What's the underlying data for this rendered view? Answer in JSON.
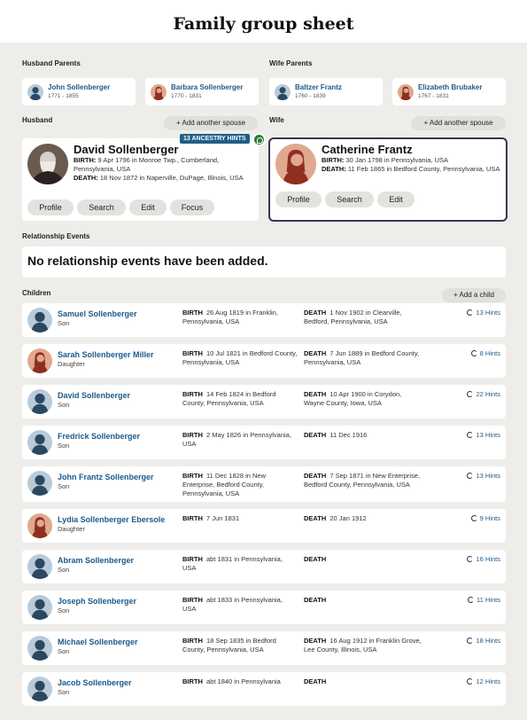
{
  "page": {
    "title": "Family group sheet"
  },
  "labels": {
    "husband_parents": "Husband Parents",
    "wife_parents": "Wife Parents",
    "husband": "Husband",
    "wife": "Wife",
    "relationship_events": "Relationship Events",
    "children": "Children",
    "add_spouse": "+ Add another spouse",
    "add_child": "+ Add a child",
    "birth": "BIRTH",
    "death": "DEATH"
  },
  "husband_parents": [
    {
      "name": "John Sollenberger",
      "dates": "1771 - 1855",
      "gender": "male"
    },
    {
      "name": "Barbara Sollenberger",
      "dates": "1770 - 1831",
      "gender": "female"
    }
  ],
  "wife_parents": [
    {
      "name": "Baltzer Frantz",
      "dates": "1760 - 1839",
      "gender": "male"
    },
    {
      "name": "Elizabeth Brubaker",
      "dates": "1767 - 1831",
      "gender": "female"
    }
  ],
  "husband": {
    "name": "David Sollenberger",
    "birth_label": "BIRTH:",
    "birth": "9 Apr 1796 in Monroe Twp., Cumberland, Pennsylvania, USA",
    "death_label": "DEATH:",
    "death": "18 Nov 1872 in Naperville, DuPage, Illinois, USA",
    "hints_badge": "13 ANCESTRY HINTS",
    "buttons": [
      "Profile",
      "Search",
      "Edit",
      "Focus"
    ]
  },
  "wife": {
    "name": "Catherine Frantz",
    "birth_label": "BIRTH:",
    "birth": "30 Jan 1798 in Pennsylvania, USA",
    "death_label": "DEATH:",
    "death": "11 Feb 1865 in Bedford County, Pennsylvania, USA",
    "buttons": [
      "Profile",
      "Search",
      "Edit"
    ]
  },
  "relationship_events": {
    "empty_text": "No relationship events have been added."
  },
  "children": [
    {
      "name": "Samuel Sollenberger",
      "relation": "Son",
      "gender": "male",
      "birth": "26 Aug 1819  in Franklin, Pennsylvania, USA",
      "death": "1 Nov 1902  in Clearville, Bedford, Pennsylvania, USA",
      "hints": "13 Hints"
    },
    {
      "name": "Sarah Sollenberger Miller",
      "relation": "Daughter",
      "gender": "female",
      "birth": "10 Jul 1821  in Bedford County, Pennsylvania, USA",
      "death": "7 Jun 1889  in Bedford County, Pennsylvania, USA",
      "hints": "8 Hints"
    },
    {
      "name": "David Sollenberger",
      "relation": "Son",
      "gender": "male",
      "birth": "14 Feb 1824  in Bedford County, Pennsylvania, USA",
      "death": "10 Apr 1900  in Corydon, Wayne County, Iowa, USA",
      "hints": "22 Hints"
    },
    {
      "name": "Fredrick Sollenberger",
      "relation": "Son",
      "gender": "male",
      "birth": "2 May 1826  in Pennsylvania, USA",
      "death": "11 Dec 1916",
      "hints": "13 Hints"
    },
    {
      "name": "John Frantz Sollenberger",
      "relation": "Son",
      "gender": "male",
      "birth": "11 Dec 1828  in New Enterprise, Bedford County, Pennsylvania, USA",
      "death": "7 Sep 1871  in New Enterprise, Bedford County, Pennsylvania, USA",
      "hints": "13 Hints"
    },
    {
      "name": "Lydia Sollenberger Ebersole",
      "relation": "Daughter",
      "gender": "female",
      "birth": "7 Jun 1831",
      "death": "20 Jan 1912",
      "hints": "9 Hints"
    },
    {
      "name": "Abram Sollenberger",
      "relation": "Son",
      "gender": "male",
      "birth": "abt 1831  in Pennsylvania, USA",
      "death": "",
      "hints": "16 Hints"
    },
    {
      "name": "Joseph Sollenberger",
      "relation": "Son",
      "gender": "male",
      "birth": "abt 1833  in Pennsylvania, USA",
      "death": "",
      "hints": "11 Hints"
    },
    {
      "name": "Michael Sollenberger",
      "relation": "Son",
      "gender": "male",
      "birth": "18 Sep 1835  in Bedford County, Pennsylvania, USA",
      "death": "16 Aug 1912  in Franklin Grove, Lee County, Illinois, USA",
      "hints": "18 Hints"
    },
    {
      "name": "Jacob Sollenberger",
      "relation": "Son",
      "gender": "male",
      "birth": "abt 1840  in Pennsylvania",
      "death": "",
      "hints": "12 Hints"
    }
  ],
  "colors": {
    "link": "#1c5a8a",
    "male_avatar_bg": "#b9cbd9",
    "male_avatar_fg": "#2b4860",
    "female_avatar_bg": "#e0a88f",
    "female_avatar_fg": "#8e2f1f",
    "wife_border": "#3a3553",
    "hints_badge": "#1f5f86",
    "leaf": "#2e7d32"
  }
}
